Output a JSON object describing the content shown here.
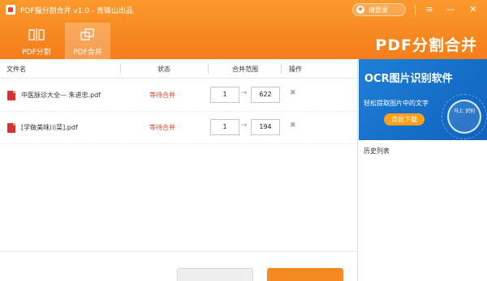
{
  "window": {
    "title": "PDF猫分割合并 v1.0 - 青锋山出品",
    "login_label": "请登录",
    "controls": {
      "menu": "≡",
      "minimize": "—",
      "close": "✕"
    }
  },
  "toolbar": {
    "tabs": [
      {
        "label": "PDF分割",
        "icon": "split-icon",
        "active": false
      },
      {
        "label": "PDF合并",
        "icon": "merge-icon",
        "active": true
      }
    ],
    "brand": "PDF分割合并"
  },
  "table": {
    "headers": {
      "file_name": "文件名",
      "status": "状态",
      "range": "合并范围",
      "action": "操作"
    },
    "rows": [
      {
        "file": "中医脉诊大全— 朱进忠.pdf",
        "status": "等待合并",
        "from": "1",
        "to": "622"
      },
      {
        "file": "[学做美味川菜].pdf",
        "status": "等待合并",
        "from": "1",
        "to": "194"
      }
    ],
    "arrow_glyph": "→",
    "delete_glyph": "✖"
  },
  "ad": {
    "title": "OCR图片识别软件",
    "subtitle": "轻松提取图片中的文字",
    "button": "点此下载",
    "circle_text": "马上 识别"
  },
  "history_label": "历史列表",
  "colors": {
    "accent": "#f58a22",
    "status_red": "#e2452b",
    "ad_blue": "#1f7fd6"
  }
}
